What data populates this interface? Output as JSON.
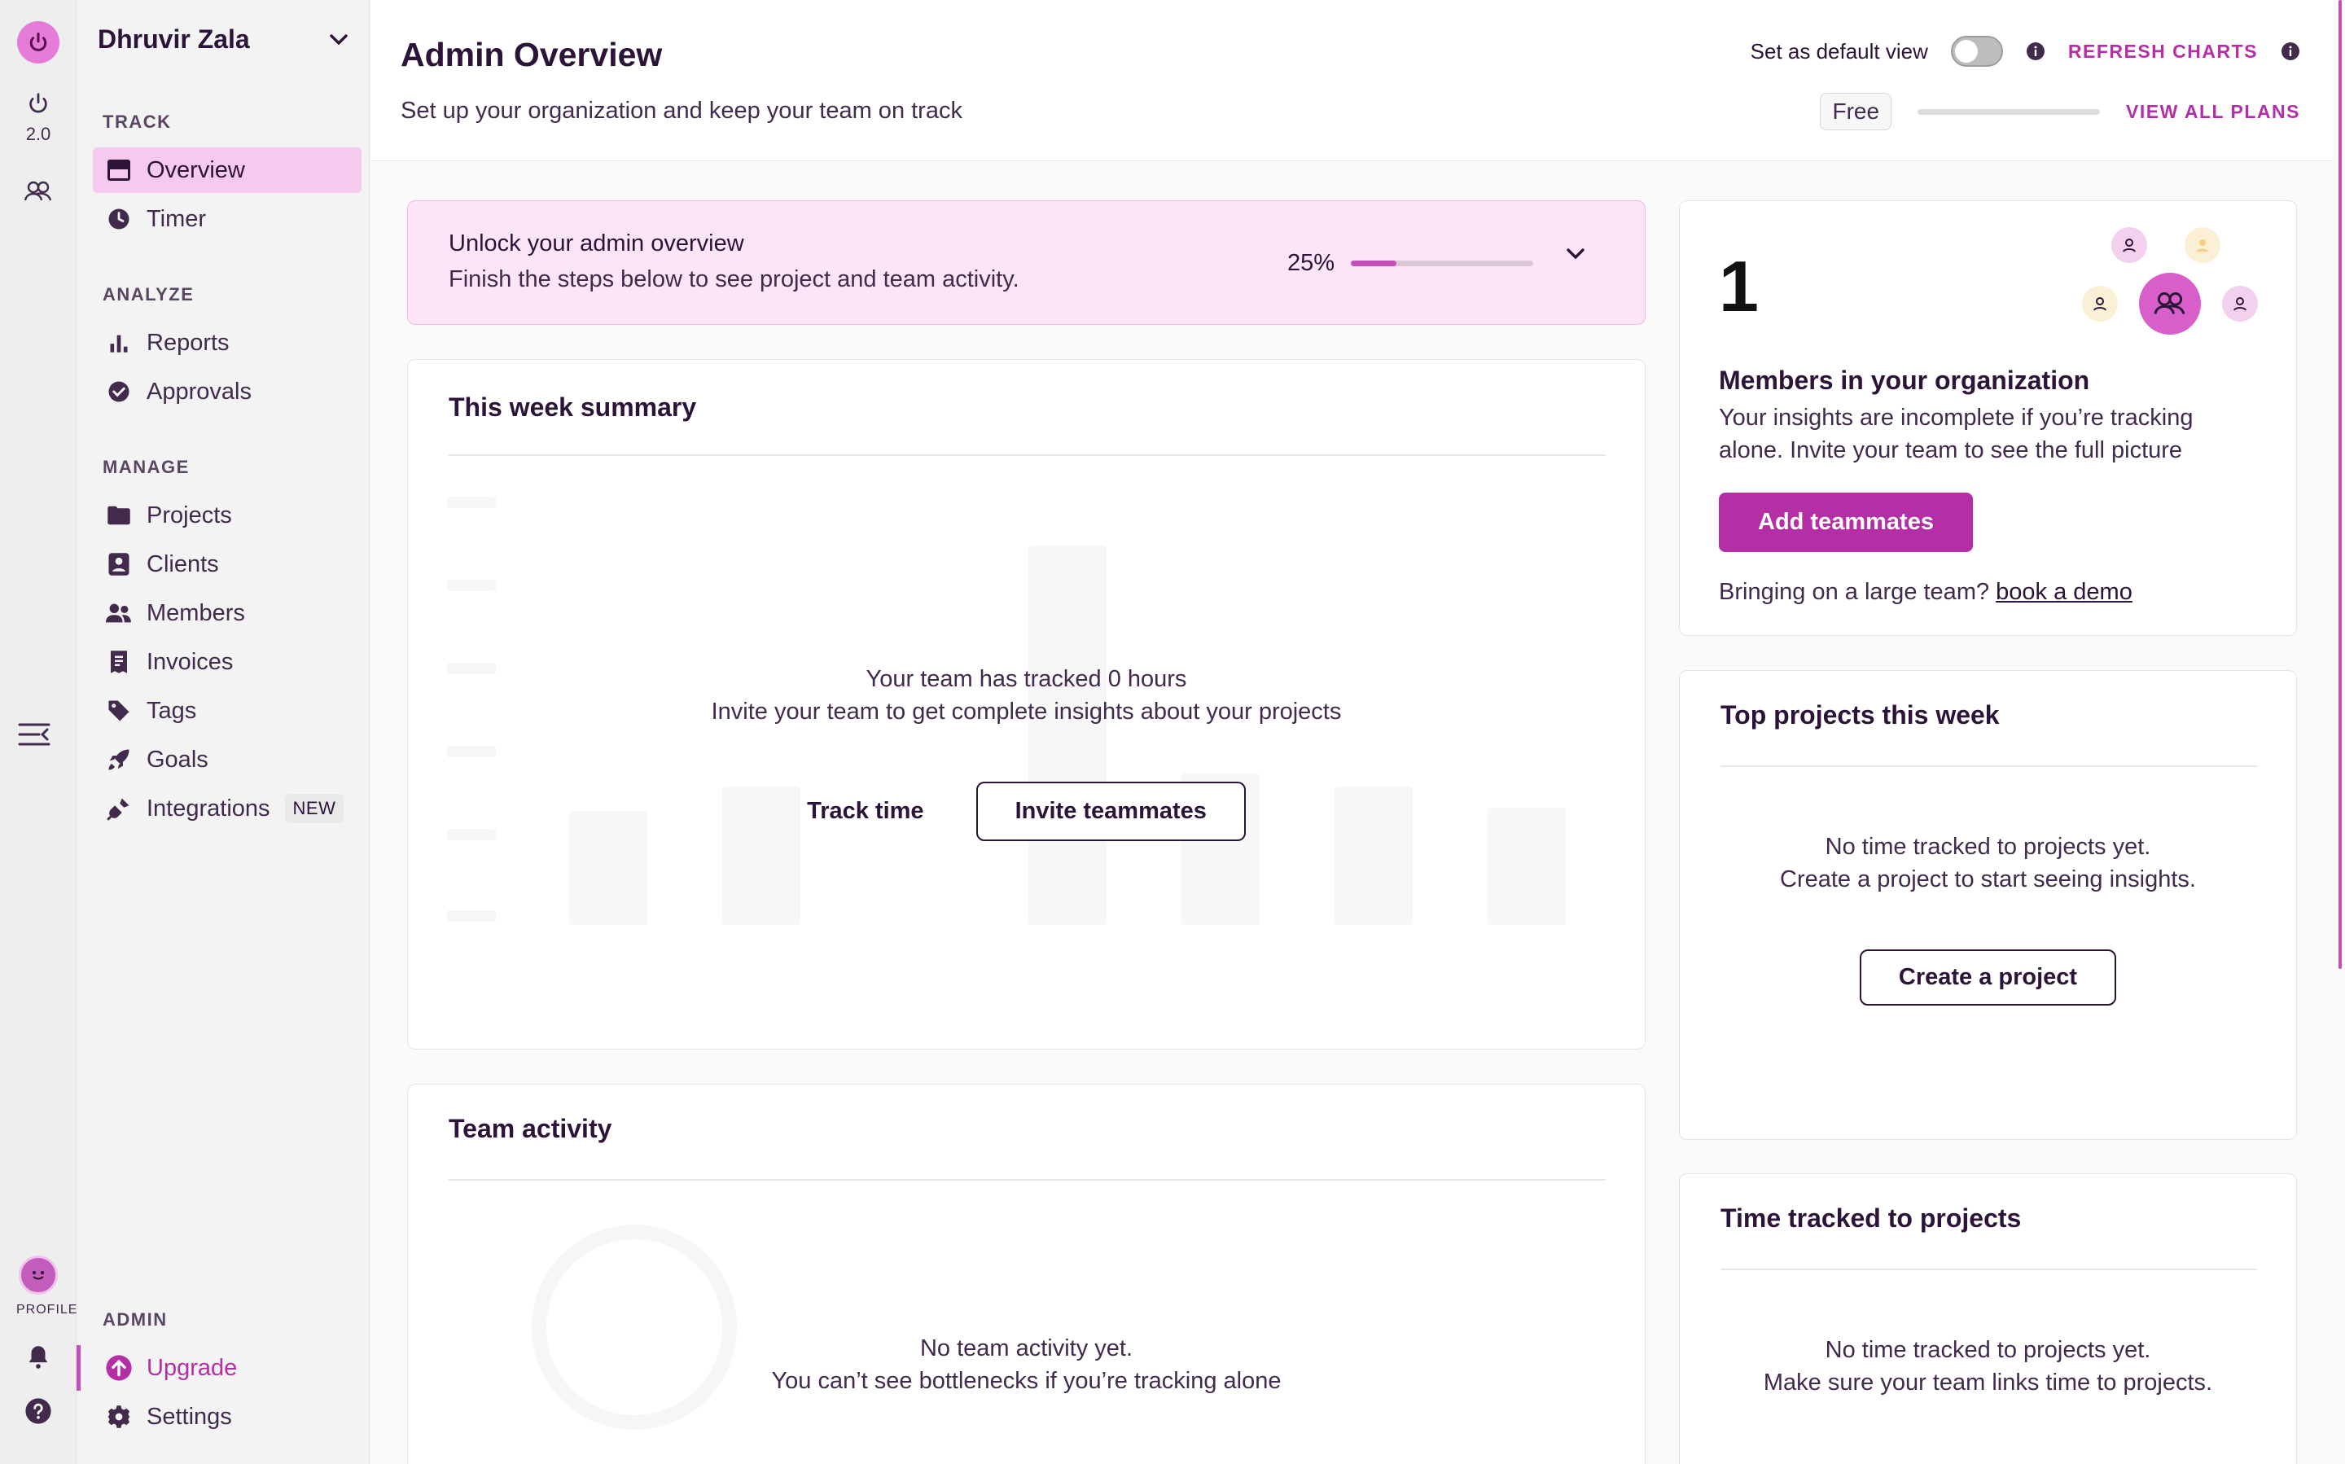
{
  "workspace": {
    "name": "Dhruvir Zala"
  },
  "rail": {
    "version": "2.0",
    "profile_label": "PROFILE"
  },
  "sidebar": {
    "sections": [
      {
        "title": "TRACK",
        "items": [
          {
            "label": "Overview",
            "icon": "overview-icon",
            "active": true
          },
          {
            "label": "Timer",
            "icon": "clock-icon"
          }
        ]
      },
      {
        "title": "ANALYZE",
        "items": [
          {
            "label": "Reports",
            "icon": "bar-chart-icon"
          },
          {
            "label": "Approvals",
            "icon": "check-circle-icon"
          }
        ]
      },
      {
        "title": "MANAGE",
        "items": [
          {
            "label": "Projects",
            "icon": "folder-icon"
          },
          {
            "label": "Clients",
            "icon": "client-icon"
          },
          {
            "label": "Members",
            "icon": "members-icon"
          },
          {
            "label": "Invoices",
            "icon": "invoice-icon"
          },
          {
            "label": "Tags",
            "icon": "tag-icon"
          },
          {
            "label": "Goals",
            "icon": "rocket-icon"
          },
          {
            "label": "Integrations",
            "icon": "plug-icon",
            "badge": "NEW"
          }
        ]
      },
      {
        "title": "ADMIN",
        "items": [
          {
            "label": "Upgrade",
            "icon": "upgrade-icon"
          },
          {
            "label": "Settings",
            "icon": "gear-icon"
          }
        ]
      }
    ]
  },
  "header": {
    "title": "Admin Overview",
    "subtitle": "Set up your organization and keep your team on track",
    "default_view_label": "Set as default view",
    "default_view_on": false,
    "refresh_label": "REFRESH CHARTS",
    "plan": "Free",
    "view_plans_label": "VIEW ALL PLANS"
  },
  "unlock": {
    "title": "Unlock your admin overview",
    "description": "Finish the steps below to see project and team activity.",
    "progress_label": "25%",
    "progress": 0.25
  },
  "summary": {
    "title": "This week summary",
    "line1": "Your team has tracked 0 hours",
    "line2": "Invite your team to get complete insights about your projects",
    "track_label": "Track time",
    "invite_label": "Invite teammates"
  },
  "team_activity": {
    "title": "Team activity",
    "line1": "No team activity yet.",
    "line2": "You can’t see bottlenecks if you’re tracking alone"
  },
  "members": {
    "count": "1",
    "title": "Members in your organization",
    "description": "Your insights are incomplete if you’re tracking alone. Invite your team to see the full picture",
    "add_label": "Add teammates",
    "demo_prefix": "Bringing on a large team?",
    "demo_link": "book a demo"
  },
  "top_projects": {
    "title": "Top projects this week",
    "line1": "No time tracked to projects yet.",
    "line2": "Create a project to start seeing insights.",
    "button": "Create a project"
  },
  "time_projects": {
    "title": "Time tracked to projects",
    "line1": "No time tracked to projects yet.",
    "line2": "Make sure your team links time to projects."
  },
  "colors": {
    "accent": "#b42ea6",
    "accent_light": "#f6c9ee",
    "text": "#2c1338",
    "banner_bg": "#fbe5f7"
  }
}
